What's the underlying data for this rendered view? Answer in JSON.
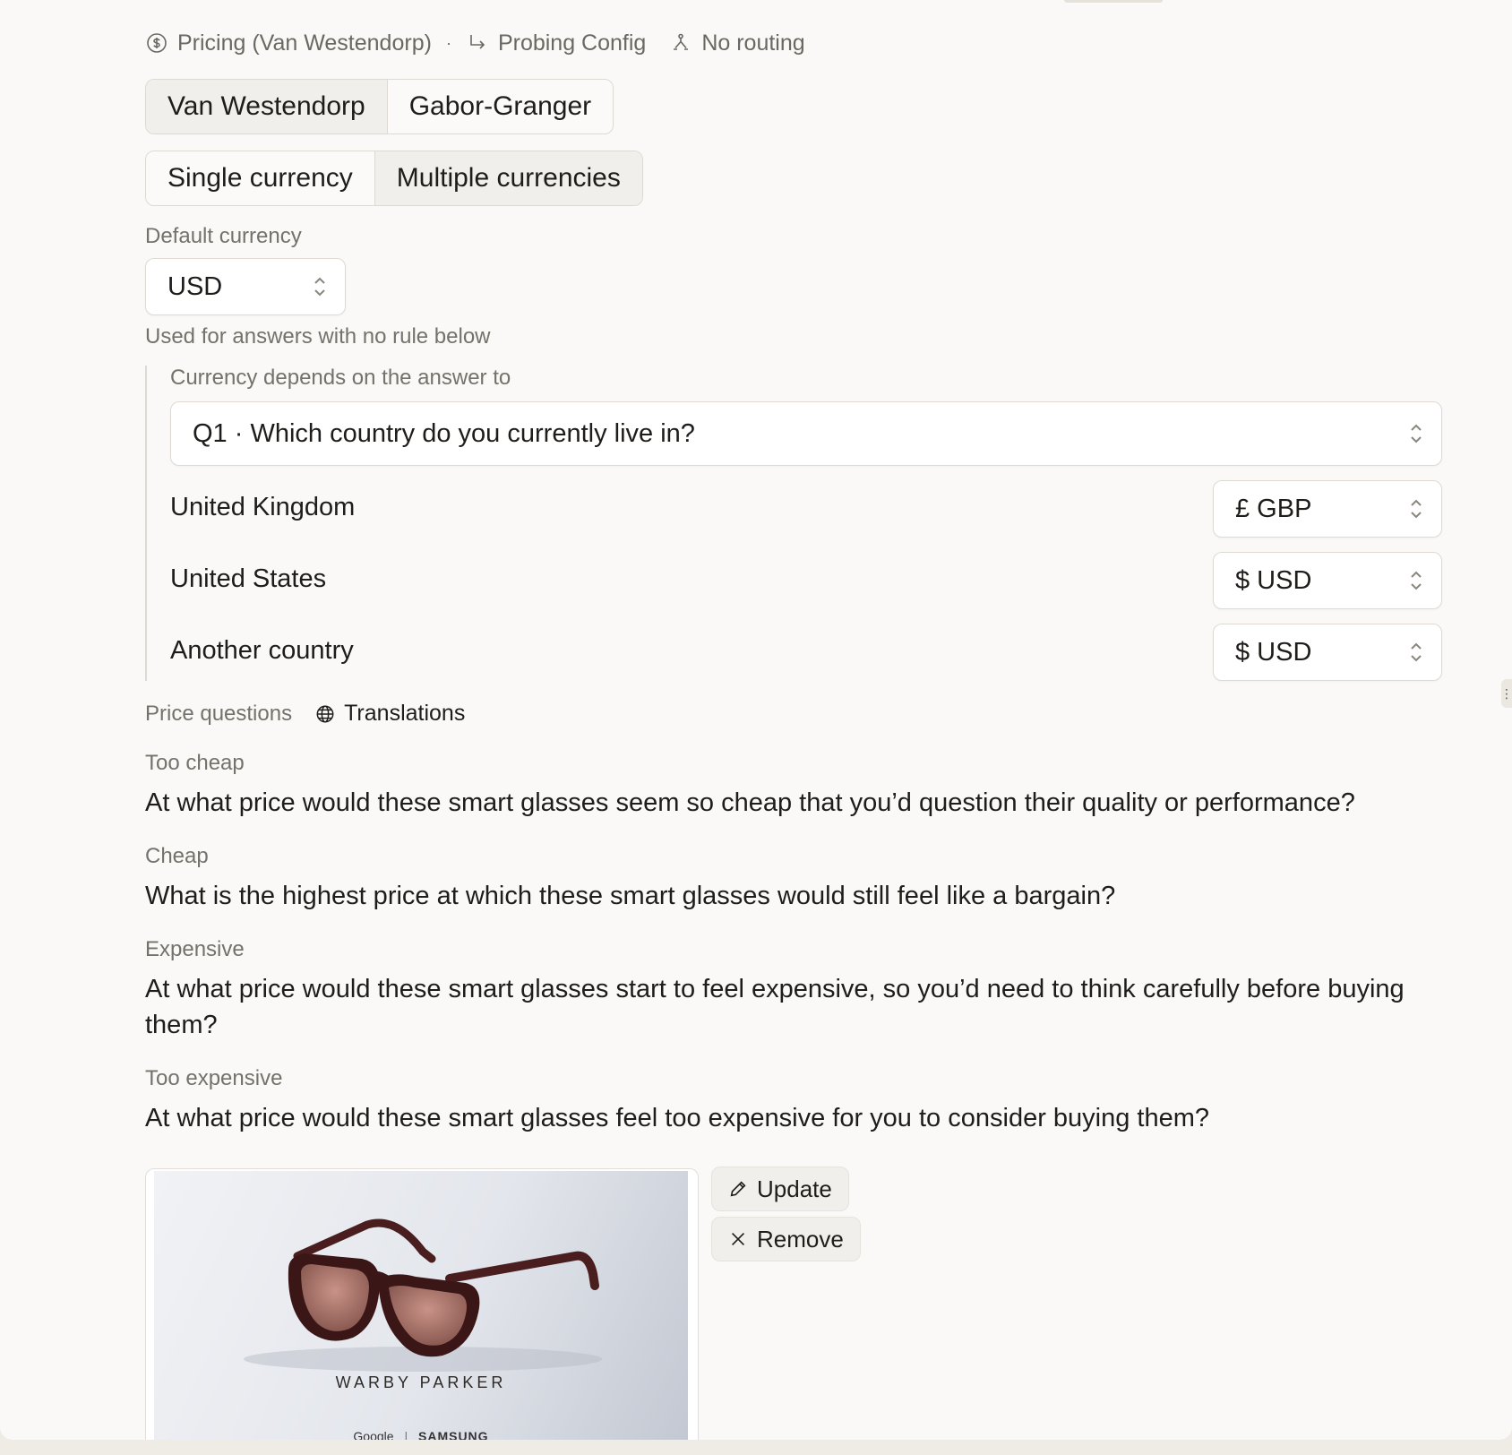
{
  "meta": {
    "type_label": "Pricing (Van Westendorp)",
    "dot": "·",
    "probing_label": "Probing Config",
    "routing_label": "No routing"
  },
  "method_toggle": {
    "options": [
      "Van Westendorp",
      "Gabor-Granger"
    ],
    "selected": "Van Westendorp"
  },
  "currency_mode_toggle": {
    "options": [
      "Single currency",
      "Multiple currencies"
    ],
    "selected": "Multiple currencies"
  },
  "default_currency": {
    "label": "Default currency",
    "value": "USD",
    "hint": "Used for answers with no rule below"
  },
  "rules": {
    "label": "Currency depends on the answer to",
    "question": "Q1 · Which country do you currently live in?",
    "rows": [
      {
        "answer": "United Kingdom",
        "currency": "£ GBP"
      },
      {
        "answer": "United States",
        "currency": "$ USD"
      },
      {
        "answer": "Another country",
        "currency": "$ USD"
      }
    ]
  },
  "price_questions": {
    "label": "Price questions",
    "translations_label": "Translations",
    "items": [
      {
        "label": "Too cheap",
        "text": "At what price would these smart glasses seem so cheap that you’d question their quality or performance?"
      },
      {
        "label": "Cheap",
        "text": "What is the highest price at which these smart glasses would still feel like a bargain?"
      },
      {
        "label": "Expensive",
        "text": "At what price would these smart glasses start to feel expensive, so you’d need to think carefully before buying them?"
      },
      {
        "label": "Too expensive",
        "text": "At what price would these smart glasses feel too expensive for you to consider buying them?"
      }
    ]
  },
  "image": {
    "brand": "WARBY PARKER",
    "cobrand_left": "Google",
    "cobrand_sep": "|",
    "cobrand_right": "SAMSUNG",
    "update_label": "Update",
    "remove_label": "Remove"
  },
  "colors": {
    "background": "#faf9f7",
    "border": "#dedad3",
    "muted_text": "#75716b",
    "text": "#1f1d1a"
  }
}
